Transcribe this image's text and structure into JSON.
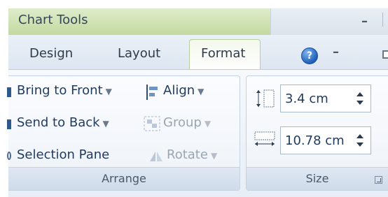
{
  "titlebar": {
    "title": "Chart Tools",
    "minimize": "–"
  },
  "tabs": [
    {
      "label": "Design"
    },
    {
      "label": "Layout"
    },
    {
      "label": "Format",
      "active": true
    }
  ],
  "ribbon_controls": {
    "help": "?",
    "minimize": "–"
  },
  "arrange_group": {
    "label": "Arrange",
    "commands": [
      {
        "label": "Bring to Front",
        "enabled": true,
        "icon": "bring-to-front-icon"
      },
      {
        "label": "Send to Back",
        "enabled": true,
        "icon": "send-to-back-icon"
      },
      {
        "label": "Selection Pane",
        "enabled": true,
        "icon": "selection-pane-icon"
      },
      {
        "label": "Align",
        "enabled": true,
        "icon": "align-icon"
      },
      {
        "label": "Group",
        "enabled": false,
        "icon": "group-icon"
      },
      {
        "label": "Rotate",
        "enabled": false,
        "icon": "rotate-icon"
      }
    ],
    "caret": "▼"
  },
  "size_group": {
    "label": "Size",
    "height": {
      "value": "3.4 cm",
      "icon": "shape-height-icon"
    },
    "width": {
      "value": "10.78 cm",
      "icon": "shape-width-icon"
    }
  },
  "colors": {
    "accent_green": "#c3d9a1",
    "ribbon_blue": "#dfe8f3",
    "text": "#1f3a5f"
  }
}
